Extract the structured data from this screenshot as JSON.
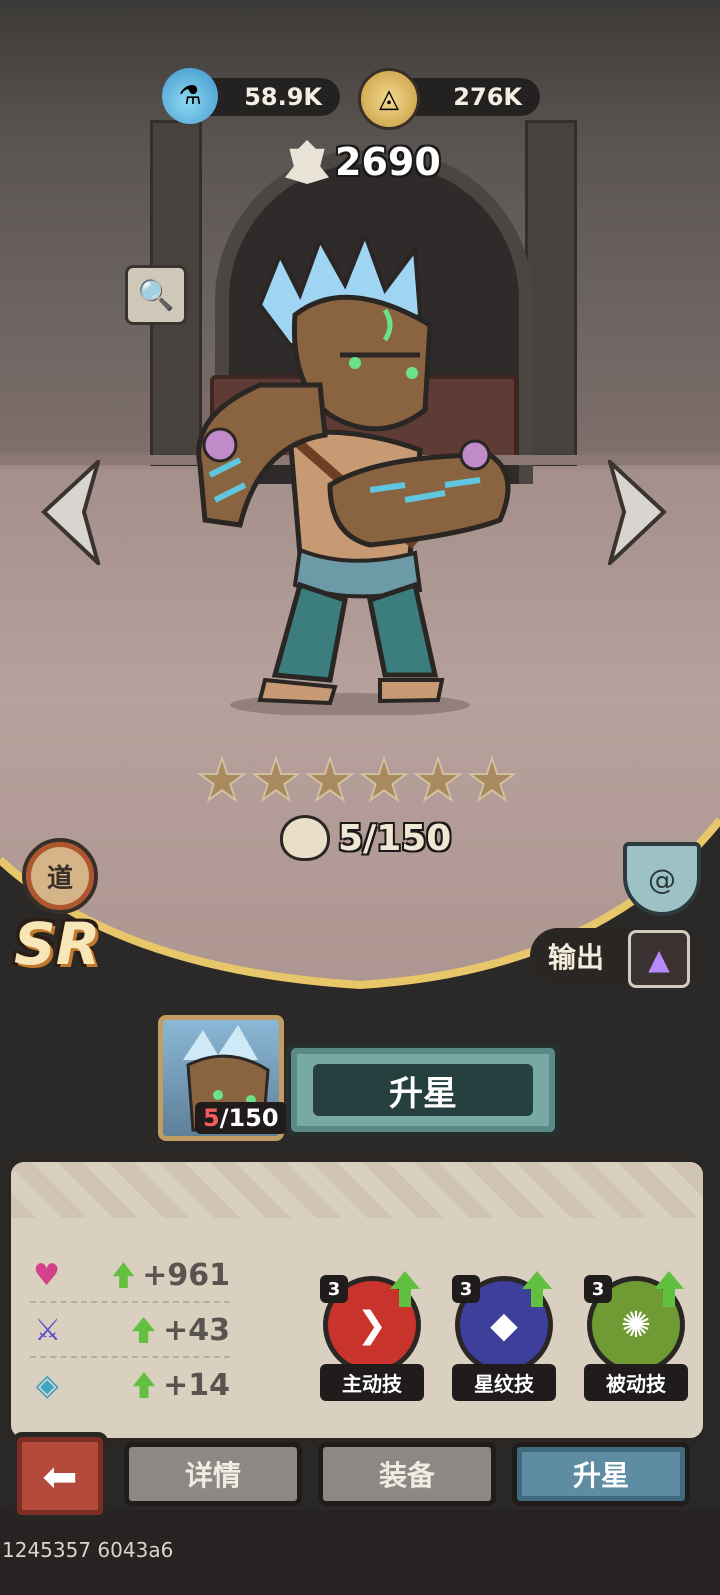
{
  "resources": {
    "potion": {
      "icon": "blue-potion-icon",
      "value": "58.9K"
    },
    "coin": {
      "icon": "gold-coin-icon",
      "value": "276K"
    }
  },
  "power": {
    "icon": "power-crest-icon",
    "value": "2690"
  },
  "hero": {
    "rarity": "SR",
    "faction_badge": "道",
    "stars": 6,
    "shards": "5/150",
    "role_label": "输出"
  },
  "upgrade": {
    "shard_current": "5",
    "shard_total": "/150",
    "button_label": "升星"
  },
  "stats": [
    {
      "icon": "health-heart-icon",
      "value": "+961"
    },
    {
      "icon": "attack-sword-icon",
      "value": "+43"
    },
    {
      "icon": "defense-shield-icon",
      "value": "+14"
    }
  ],
  "skills": [
    {
      "level": "3",
      "label": "主动技",
      "icon": "active-skill-icon",
      "color": "#c8342c"
    },
    {
      "level": "3",
      "label": "星纹技",
      "icon": "star-rune-skill-icon",
      "color": "#3d3f9a"
    },
    {
      "level": "3",
      "label": "被动技",
      "icon": "passive-skill-icon",
      "color": "#6f9a34"
    }
  ],
  "tabs": [
    {
      "label": "详情",
      "active": false
    },
    {
      "label": "装备",
      "active": false
    },
    {
      "label": "升星",
      "active": true
    }
  ],
  "build_id": "1245357 6043a6"
}
